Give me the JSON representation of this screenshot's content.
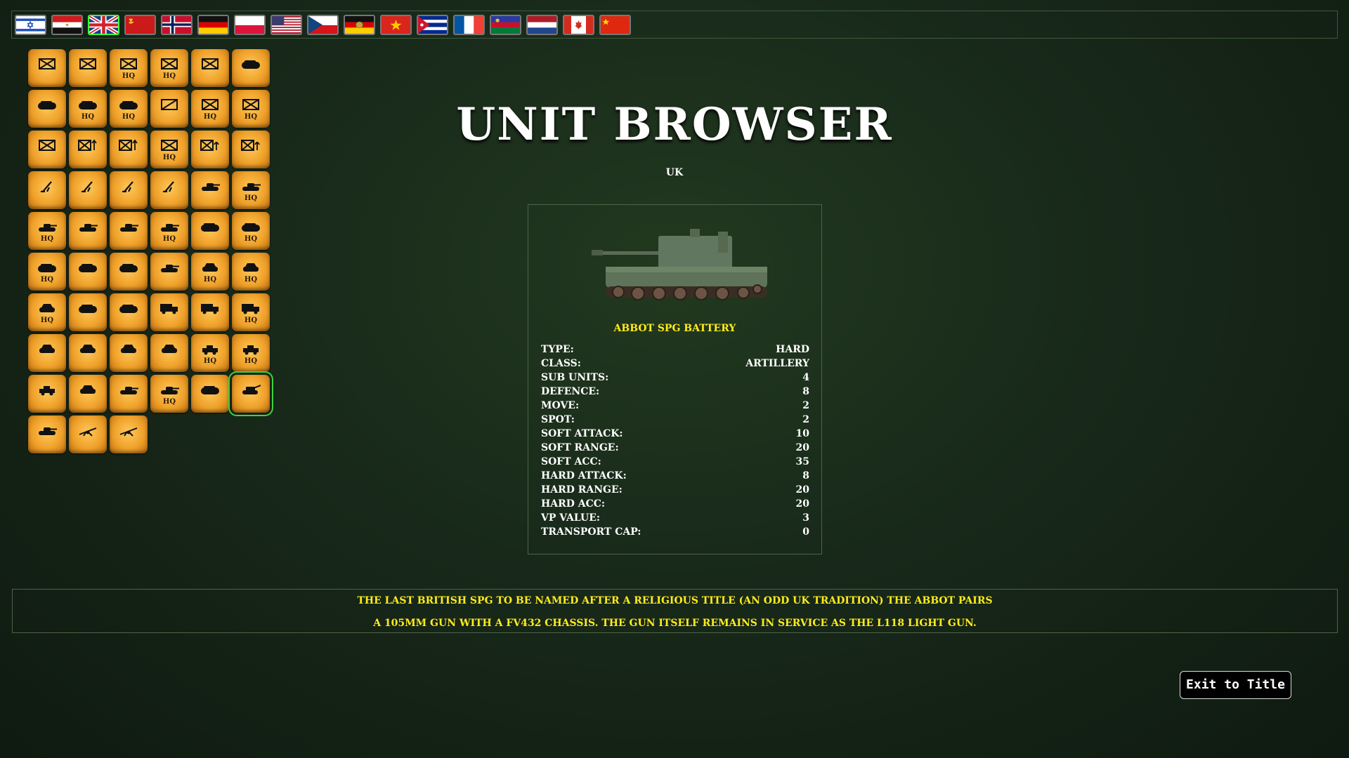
{
  "flags": [
    {
      "name": "israel"
    },
    {
      "name": "egypt"
    },
    {
      "name": "uk",
      "selected": true
    },
    {
      "name": "ussr"
    },
    {
      "name": "norway"
    },
    {
      "name": "west-germany"
    },
    {
      "name": "poland"
    },
    {
      "name": "usa"
    },
    {
      "name": "czechoslovakia"
    },
    {
      "name": "east-germany"
    },
    {
      "name": "vietnam"
    },
    {
      "name": "cuba"
    },
    {
      "name": "france"
    },
    {
      "name": "afghanistan"
    },
    {
      "name": "netherlands"
    },
    {
      "name": "canada"
    },
    {
      "name": "china"
    }
  ],
  "units": [
    {
      "icon": "infantry-icon",
      "hq": ""
    },
    {
      "icon": "infantry-icon",
      "hq": ""
    },
    {
      "icon": "infantry-icon",
      "hq": "HQ"
    },
    {
      "icon": "infantry-icon",
      "hq": "HQ"
    },
    {
      "icon": "infantry-icon",
      "hq": ""
    },
    {
      "icon": "apc-icon",
      "hq": ""
    },
    {
      "icon": "apc-icon",
      "hq": ""
    },
    {
      "icon": "apc-icon",
      "hq": "HQ"
    },
    {
      "icon": "apc-icon",
      "hq": "HQ"
    },
    {
      "icon": "recon-icon",
      "hq": ""
    },
    {
      "icon": "infantry-icon",
      "hq": "HQ"
    },
    {
      "icon": "infantry-icon",
      "hq": "HQ"
    },
    {
      "icon": "infantry-icon",
      "hq": ""
    },
    {
      "icon": "infantry-at-icon",
      "hq": ""
    },
    {
      "icon": "infantry-at-icon",
      "hq": ""
    },
    {
      "icon": "infantry-icon",
      "hq": "HQ"
    },
    {
      "icon": "infantry-aa-icon",
      "hq": ""
    },
    {
      "icon": "infantry-aa-icon",
      "hq": ""
    },
    {
      "icon": "mortar-icon",
      "hq": ""
    },
    {
      "icon": "mortar-icon",
      "hq": ""
    },
    {
      "icon": "mortar-icon",
      "hq": ""
    },
    {
      "icon": "mortar-icon",
      "hq": ""
    },
    {
      "icon": "tank-icon",
      "hq": ""
    },
    {
      "icon": "tank-icon",
      "hq": "HQ"
    },
    {
      "icon": "tank-icon",
      "hq": "HQ"
    },
    {
      "icon": "tank-icon",
      "hq": ""
    },
    {
      "icon": "tank-icon",
      "hq": ""
    },
    {
      "icon": "tank-icon",
      "hq": "HQ"
    },
    {
      "icon": "apc-icon",
      "hq": ""
    },
    {
      "icon": "apc-icon",
      "hq": "HQ"
    },
    {
      "icon": "apc-icon",
      "hq": "HQ"
    },
    {
      "icon": "apc-icon",
      "hq": ""
    },
    {
      "icon": "apc-icon",
      "hq": ""
    },
    {
      "icon": "tank-icon",
      "hq": ""
    },
    {
      "icon": "scout-car-icon",
      "hq": "HQ"
    },
    {
      "icon": "scout-car-icon",
      "hq": "HQ"
    },
    {
      "icon": "scout-car-icon",
      "hq": "HQ"
    },
    {
      "icon": "apc-icon",
      "hq": ""
    },
    {
      "icon": "apc-icon",
      "hq": ""
    },
    {
      "icon": "truck-icon",
      "hq": ""
    },
    {
      "icon": "truck-icon",
      "hq": ""
    },
    {
      "icon": "truck-icon",
      "hq": "HQ"
    },
    {
      "icon": "scout-car-icon",
      "hq": ""
    },
    {
      "icon": "scout-car-icon",
      "hq": ""
    },
    {
      "icon": "scout-car-icon",
      "hq": ""
    },
    {
      "icon": "scout-car-icon",
      "hq": ""
    },
    {
      "icon": "jeep-icon",
      "hq": "HQ"
    },
    {
      "icon": "jeep-icon",
      "hq": "HQ"
    },
    {
      "icon": "jeep-icon",
      "hq": ""
    },
    {
      "icon": "scout-car-icon",
      "hq": ""
    },
    {
      "icon": "tank-icon",
      "hq": ""
    },
    {
      "icon": "tank-icon",
      "hq": "HQ"
    },
    {
      "icon": "apc-icon",
      "hq": ""
    },
    {
      "icon": "spg-icon",
      "hq": "",
      "selected": true
    },
    {
      "icon": "tank-icon",
      "hq": ""
    },
    {
      "icon": "towed-gun-icon",
      "hq": ""
    },
    {
      "icon": "towed-gun-icon",
      "hq": ""
    }
  ],
  "title": "UNIT BROWSER",
  "nation": "UK",
  "unit": {
    "name": "ABBOT SPG BATTERY",
    "stats": [
      {
        "label": "TYPE:",
        "value": "HARD"
      },
      {
        "label": "CLASS:",
        "value": "ARTILLERY"
      },
      {
        "label": "SUB UNITS:",
        "value": "4"
      },
      {
        "label": "DEFENCE:",
        "value": "8"
      },
      {
        "label": "MOVE:",
        "value": "2"
      },
      {
        "label": "SPOT:",
        "value": "2"
      },
      {
        "label": "SOFT ATTACK:",
        "value": "10"
      },
      {
        "label": "SOFT RANGE:",
        "value": "20"
      },
      {
        "label": "SOFT ACC:",
        "value": "35"
      },
      {
        "label": "HARD ATTACK:",
        "value": "8"
      },
      {
        "label": "HARD RANGE:",
        "value": "20"
      },
      {
        "label": "HARD ACC:",
        "value": "20"
      },
      {
        "label": "VP VALUE:",
        "value": "3"
      },
      {
        "label": "TRANSPORT CAP:",
        "value": "0"
      }
    ]
  },
  "description": {
    "line1": "THE LAST BRITISH SPG TO BE NAMED AFTER A RELIGIOUS TITLE (AN ODD UK TRADITION) THE ABBOT PAIRS",
    "line2": "A 105MM GUN WITH A FV432 CHASSIS. THE GUN ITSELF REMAINS IN SERVICE AS THE L118 LIGHT GUN."
  },
  "exit_label": "Exit to Title"
}
